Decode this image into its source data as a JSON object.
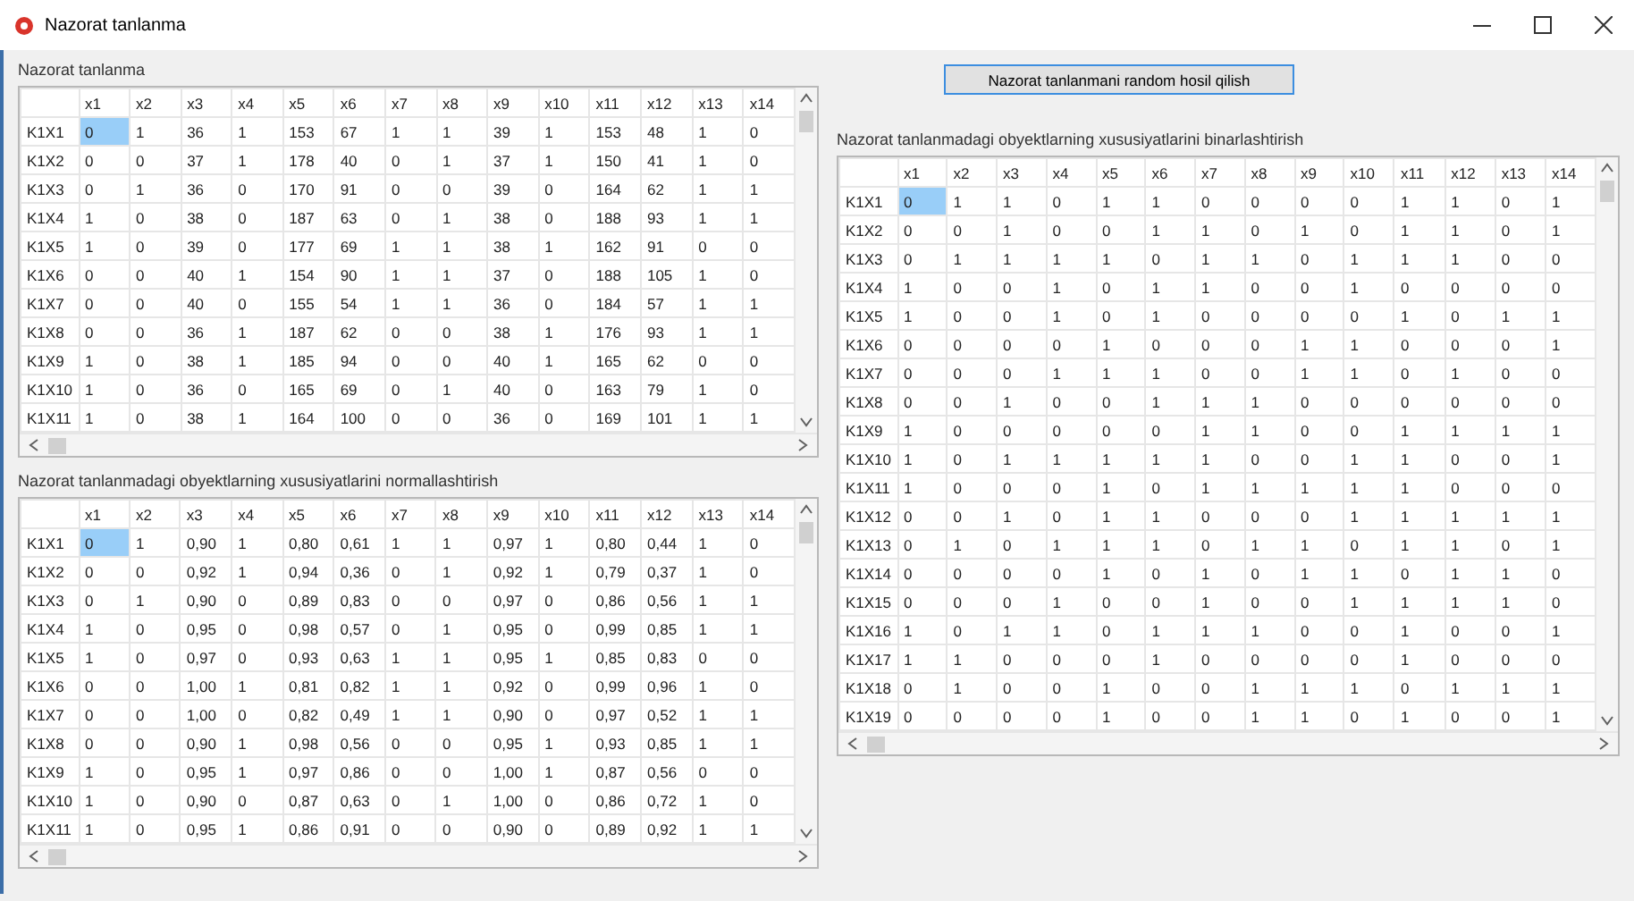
{
  "window": {
    "title": "Nazorat tanlanma"
  },
  "sample": {
    "title": "Nazorat tanlanma",
    "columns": [
      "x1",
      "x2",
      "x3",
      "x4",
      "x5",
      "x6",
      "x7",
      "x8",
      "x9",
      "x10",
      "x11",
      "x12",
      "x13",
      "x14"
    ],
    "rows": [
      {
        "label": "K1X1",
        "selected": true,
        "cells": [
          "0",
          "1",
          "36",
          "1",
          "153",
          "67",
          "1",
          "1",
          "39",
          "1",
          "153",
          "48",
          "1",
          "0"
        ]
      },
      {
        "label": "K1X2",
        "selected": false,
        "cells": [
          "0",
          "0",
          "37",
          "1",
          "178",
          "40",
          "0",
          "1",
          "37",
          "1",
          "150",
          "41",
          "1",
          "0"
        ]
      },
      {
        "label": "K1X3",
        "selected": false,
        "cells": [
          "0",
          "1",
          "36",
          "0",
          "170",
          "91",
          "0",
          "0",
          "39",
          "0",
          "164",
          "62",
          "1",
          "1"
        ]
      },
      {
        "label": "K1X4",
        "selected": false,
        "cells": [
          "1",
          "0",
          "38",
          "0",
          "187",
          "63",
          "0",
          "1",
          "38",
          "0",
          "188",
          "93",
          "1",
          "1"
        ]
      },
      {
        "label": "K1X5",
        "selected": false,
        "cells": [
          "1",
          "0",
          "39",
          "0",
          "177",
          "69",
          "1",
          "1",
          "38",
          "1",
          "162",
          "91",
          "0",
          "0"
        ]
      },
      {
        "label": "K1X6",
        "selected": false,
        "cells": [
          "0",
          "0",
          "40",
          "1",
          "154",
          "90",
          "1",
          "1",
          "37",
          "0",
          "188",
          "105",
          "1",
          "0"
        ]
      },
      {
        "label": "K1X7",
        "selected": false,
        "cells": [
          "0",
          "0",
          "40",
          "0",
          "155",
          "54",
          "1",
          "1",
          "36",
          "0",
          "184",
          "57",
          "1",
          "1"
        ]
      },
      {
        "label": "K1X8",
        "selected": false,
        "cells": [
          "0",
          "0",
          "36",
          "1",
          "187",
          "62",
          "0",
          "0",
          "38",
          "1",
          "176",
          "93",
          "1",
          "1"
        ]
      },
      {
        "label": "K1X9",
        "selected": false,
        "cells": [
          "1",
          "0",
          "38",
          "1",
          "185",
          "94",
          "0",
          "0",
          "40",
          "1",
          "165",
          "62",
          "0",
          "0"
        ]
      },
      {
        "label": "K1X10",
        "selected": false,
        "cells": [
          "1",
          "0",
          "36",
          "0",
          "165",
          "69",
          "0",
          "1",
          "40",
          "0",
          "163",
          "79",
          "1",
          "0"
        ]
      },
      {
        "label": "K1X11",
        "selected": false,
        "cells": [
          "1",
          "0",
          "38",
          "1",
          "164",
          "100",
          "0",
          "0",
          "36",
          "0",
          "169",
          "101",
          "1",
          "1"
        ]
      }
    ]
  },
  "normalized": {
    "title": "Nazorat tanlanmadagi obyektlarning xususiyatlarini normallashtirish",
    "columns": [
      "x1",
      "x2",
      "x3",
      "x4",
      "x5",
      "x6",
      "x7",
      "x8",
      "x9",
      "x10",
      "x11",
      "x12",
      "x13",
      "x14"
    ],
    "rows": [
      {
        "label": "K1X1",
        "selected": true,
        "cells": [
          "0",
          "1",
          "0,90",
          "1",
          "0,80",
          "0,61",
          "1",
          "1",
          "0,97",
          "1",
          "0,80",
          "0,44",
          "1",
          "0"
        ]
      },
      {
        "label": "K1X2",
        "selected": false,
        "cells": [
          "0",
          "0",
          "0,92",
          "1",
          "0,94",
          "0,36",
          "0",
          "1",
          "0,92",
          "1",
          "0,79",
          "0,37",
          "1",
          "0"
        ]
      },
      {
        "label": "K1X3",
        "selected": false,
        "cells": [
          "0",
          "1",
          "0,90",
          "0",
          "0,89",
          "0,83",
          "0",
          "0",
          "0,97",
          "0",
          "0,86",
          "0,56",
          "1",
          "1"
        ]
      },
      {
        "label": "K1X4",
        "selected": false,
        "cells": [
          "1",
          "0",
          "0,95",
          "0",
          "0,98",
          "0,57",
          "0",
          "1",
          "0,95",
          "0",
          "0,99",
          "0,85",
          "1",
          "1"
        ]
      },
      {
        "label": "K1X5",
        "selected": false,
        "cells": [
          "1",
          "0",
          "0,97",
          "0",
          "0,93",
          "0,63",
          "1",
          "1",
          "0,95",
          "1",
          "0,85",
          "0,83",
          "0",
          "0"
        ]
      },
      {
        "label": "K1X6",
        "selected": false,
        "cells": [
          "0",
          "0",
          "1,00",
          "1",
          "0,81",
          "0,82",
          "1",
          "1",
          "0,92",
          "0",
          "0,99",
          "0,96",
          "1",
          "0"
        ]
      },
      {
        "label": "K1X7",
        "selected": false,
        "cells": [
          "0",
          "0",
          "1,00",
          "0",
          "0,82",
          "0,49",
          "1",
          "1",
          "0,90",
          "0",
          "0,97",
          "0,52",
          "1",
          "1"
        ]
      },
      {
        "label": "K1X8",
        "selected": false,
        "cells": [
          "0",
          "0",
          "0,90",
          "1",
          "0,98",
          "0,56",
          "0",
          "0",
          "0,95",
          "1",
          "0,93",
          "0,85",
          "1",
          "1"
        ]
      },
      {
        "label": "K1X9",
        "selected": false,
        "cells": [
          "1",
          "0",
          "0,95",
          "1",
          "0,97",
          "0,86",
          "0",
          "0",
          "1,00",
          "1",
          "0,87",
          "0,56",
          "0",
          "0"
        ]
      },
      {
        "label": "K1X10",
        "selected": false,
        "cells": [
          "1",
          "0",
          "0,90",
          "0",
          "0,87",
          "0,63",
          "0",
          "1",
          "1,00",
          "0",
          "0,86",
          "0,72",
          "1",
          "0"
        ]
      },
      {
        "label": "K1X11",
        "selected": false,
        "cells": [
          "1",
          "0",
          "0,95",
          "1",
          "0,86",
          "0,91",
          "0",
          "0",
          "0,90",
          "0",
          "0,89",
          "0,92",
          "1",
          "1"
        ]
      }
    ]
  },
  "generate_button": "Nazorat tanlanmani random hosil qilish",
  "binarized": {
    "title": "Nazorat tanlanmadagi obyektlarning xususiyatlarini binarlashtirish",
    "columns": [
      "x1",
      "x2",
      "x3",
      "x4",
      "x5",
      "x6",
      "x7",
      "x8",
      "x9",
      "x10",
      "x11",
      "x12",
      "x13",
      "x14"
    ],
    "rows": [
      {
        "label": "K1X1",
        "selected": true,
        "cells": [
          "0",
          "1",
          "1",
          "0",
          "1",
          "1",
          "0",
          "0",
          "0",
          "0",
          "1",
          "1",
          "0",
          "1"
        ]
      },
      {
        "label": "K1X2",
        "selected": false,
        "cells": [
          "0",
          "0",
          "1",
          "0",
          "0",
          "1",
          "1",
          "0",
          "1",
          "0",
          "1",
          "1",
          "0",
          "1"
        ]
      },
      {
        "label": "K1X3",
        "selected": false,
        "cells": [
          "0",
          "1",
          "1",
          "1",
          "1",
          "0",
          "1",
          "1",
          "0",
          "1",
          "1",
          "1",
          "0",
          "0"
        ]
      },
      {
        "label": "K1X4",
        "selected": false,
        "cells": [
          "1",
          "0",
          "0",
          "1",
          "0",
          "1",
          "1",
          "0",
          "0",
          "1",
          "0",
          "0",
          "0",
          "0"
        ]
      },
      {
        "label": "K1X5",
        "selected": false,
        "cells": [
          "1",
          "0",
          "0",
          "1",
          "0",
          "1",
          "0",
          "0",
          "0",
          "0",
          "1",
          "0",
          "1",
          "1"
        ]
      },
      {
        "label": "K1X6",
        "selected": false,
        "cells": [
          "0",
          "0",
          "0",
          "0",
          "1",
          "0",
          "0",
          "0",
          "1",
          "1",
          "0",
          "0",
          "0",
          "1"
        ]
      },
      {
        "label": "K1X7",
        "selected": false,
        "cells": [
          "0",
          "0",
          "0",
          "1",
          "1",
          "1",
          "0",
          "0",
          "1",
          "1",
          "0",
          "1",
          "0",
          "0"
        ]
      },
      {
        "label": "K1X8",
        "selected": false,
        "cells": [
          "0",
          "0",
          "1",
          "0",
          "0",
          "1",
          "1",
          "1",
          "0",
          "0",
          "0",
          "0",
          "0",
          "0"
        ]
      },
      {
        "label": "K1X9",
        "selected": false,
        "cells": [
          "1",
          "0",
          "0",
          "0",
          "0",
          "0",
          "1",
          "1",
          "0",
          "0",
          "1",
          "1",
          "1",
          "1"
        ]
      },
      {
        "label": "K1X10",
        "selected": false,
        "cells": [
          "1",
          "0",
          "1",
          "1",
          "1",
          "1",
          "1",
          "0",
          "0",
          "1",
          "1",
          "0",
          "0",
          "1"
        ]
      },
      {
        "label": "K1X11",
        "selected": false,
        "cells": [
          "1",
          "0",
          "0",
          "0",
          "1",
          "0",
          "1",
          "1",
          "1",
          "1",
          "1",
          "0",
          "0",
          "0"
        ]
      },
      {
        "label": "K1X12",
        "selected": false,
        "cells": [
          "0",
          "0",
          "1",
          "0",
          "1",
          "1",
          "0",
          "0",
          "0",
          "1",
          "1",
          "1",
          "1",
          "1"
        ]
      },
      {
        "label": "K1X13",
        "selected": false,
        "cells": [
          "0",
          "1",
          "0",
          "1",
          "1",
          "1",
          "0",
          "1",
          "1",
          "0",
          "1",
          "1",
          "0",
          "1"
        ]
      },
      {
        "label": "K1X14",
        "selected": false,
        "cells": [
          "0",
          "0",
          "0",
          "0",
          "1",
          "0",
          "1",
          "0",
          "1",
          "1",
          "0",
          "1",
          "1",
          "0"
        ]
      },
      {
        "label": "K1X15",
        "selected": false,
        "cells": [
          "0",
          "0",
          "0",
          "1",
          "0",
          "0",
          "1",
          "0",
          "0",
          "1",
          "1",
          "1",
          "1",
          "0"
        ]
      },
      {
        "label": "K1X16",
        "selected": false,
        "cells": [
          "1",
          "0",
          "1",
          "1",
          "0",
          "1",
          "1",
          "1",
          "0",
          "0",
          "1",
          "0",
          "0",
          "1"
        ]
      },
      {
        "label": "K1X17",
        "selected": false,
        "cells": [
          "1",
          "1",
          "0",
          "0",
          "0",
          "1",
          "0",
          "0",
          "0",
          "0",
          "1",
          "0",
          "0",
          "0"
        ]
      },
      {
        "label": "K1X18",
        "selected": false,
        "cells": [
          "0",
          "1",
          "0",
          "0",
          "1",
          "0",
          "0",
          "1",
          "1",
          "1",
          "0",
          "1",
          "1",
          "1"
        ]
      },
      {
        "label": "K1X19",
        "selected": false,
        "cells": [
          "0",
          "0",
          "0",
          "0",
          "1",
          "0",
          "0",
          "1",
          "1",
          "0",
          "1",
          "0",
          "0",
          "1"
        ]
      }
    ]
  }
}
